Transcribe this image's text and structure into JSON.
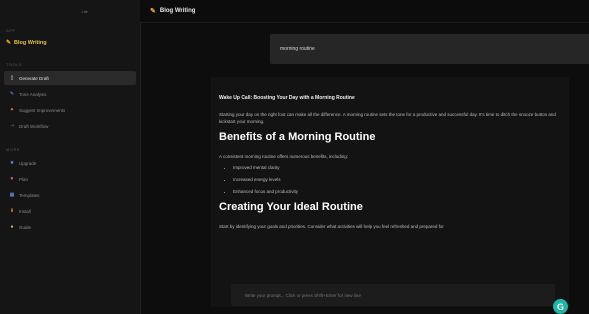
{
  "header": {
    "title": "Blog Writing"
  },
  "sidebar": {
    "top_label": "Lite",
    "section1": "APP",
    "brand": "Blog Writing",
    "section2": "TOOLS",
    "items": [
      {
        "label": "Generate Draft",
        "icon": "document-icon",
        "active": true
      },
      {
        "label": "Tone Analysis",
        "icon": "pencil-icon",
        "active": false
      },
      {
        "label": "Suggest Improvements",
        "icon": "sparkle-icon",
        "active": false
      },
      {
        "label": "Draft Workflow",
        "icon": "flow-icon",
        "active": false
      }
    ],
    "section3": "MORE",
    "items2": [
      {
        "label": "Upgrade",
        "icon": "star-icon"
      },
      {
        "label": "Plan",
        "icon": "heart-icon"
      },
      {
        "label": "Templates",
        "icon": "grid-icon"
      },
      {
        "label": "Install",
        "icon": "download-icon"
      },
      {
        "label": "Guide",
        "icon": "info-icon"
      }
    ]
  },
  "prompt": {
    "value": "morning routine"
  },
  "document": {
    "title": "Wake Up Call: Boosting Your Day with a Morning Routine",
    "intro": "Starting your day on the right foot can make all the difference. A morning routine sets the tone for a productive and successful day. It's time to ditch the snooze button and kickstart your morning.",
    "h2_benefits": "Benefits of a Morning Routine",
    "benefits_intro": "A consistent morning routine offers numerous benefits, including:",
    "benefits": [
      "Improved mental clarity",
      "Increased energy levels",
      "Enhanced focus and productivity"
    ],
    "h2_creating": "Creating Your Ideal Routine",
    "creating_p": "Start by identifying your goals and priorities. Consider what activities will help you feel refreshed and prepared for"
  },
  "chat": {
    "placeholder": "Write your prompt... Click or press Shift+Enter for new line"
  },
  "fab": {
    "label": "G"
  },
  "colors": {
    "accent": "#e8a31a",
    "fab": "#1fb6a6"
  }
}
